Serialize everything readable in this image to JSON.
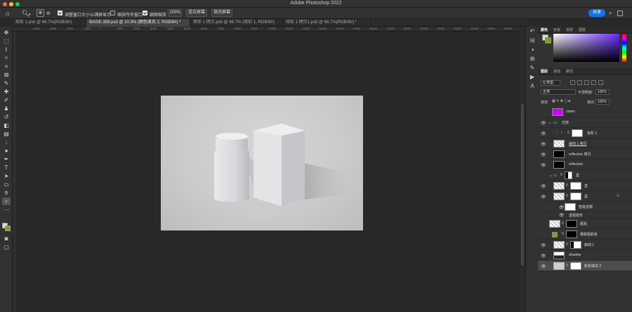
{
  "app": {
    "title": "Adobe Photoshop 2022"
  },
  "options_bar": {
    "resize_windows_label": "调整窗口大小以满屏显示",
    "zoom_all_label": "缩放所有窗口",
    "scrubby_zoom_label": "细微缩放",
    "zoom_value": "100%",
    "fit_screen_label": "适合屏幕",
    "fill_screen_label": "填充屏幕",
    "share_label": "共享"
  },
  "tabs": [
    {
      "label": "矩形 1.psb @ 66.7%(RGB/8#)"
    },
    {
      "label": "BAISE.359.psd @ 10.3% (颜色填充 2, RGB/8#) *"
    },
    {
      "label": "矩形 1 拷贝.psb @ 66.7% (矩形 1, RGB/8#)"
    },
    {
      "label": "矩形 1 拷贝1.psb @ 66.7%(RGB/8#) *"
    }
  ],
  "ruler": {
    "ticks": [
      "-4000",
      "-3000",
      "-2000",
      "-1000",
      "0",
      "1000",
      "2000",
      "3000",
      "4000",
      "5000",
      "6000",
      "7000",
      "8000",
      "9000",
      "10000",
      "11000",
      "12000",
      "13000",
      "14000",
      "15000",
      "16000",
      "17000",
      "18000",
      "19000",
      "20000",
      "21000",
      "22000",
      "23000",
      "24000",
      "25000",
      "26000"
    ]
  },
  "color_panel": {
    "tabs": [
      "颜色",
      "色板",
      "渐变",
      "图案"
    ],
    "fg": "#d7e2d1",
    "bg": "#7ba31c"
  },
  "layers_panel": {
    "tabs": [
      "图层",
      "通道",
      "路径"
    ],
    "filter_label": "Q 类型",
    "blend_mode": "正常",
    "opacity_label": "不透明度:",
    "opacity_value": "100%",
    "lock_label": "锁定:",
    "fill_label": "填充:",
    "fill_value": "100%",
    "layers": [
      {
        "name": "clown"
      },
      {
        "name": "光效"
      },
      {
        "name": "色阶 1"
      },
      {
        "name": "曲线 1 拷贝"
      },
      {
        "name": "reflection 拷贝"
      },
      {
        "name": "reflection"
      },
      {
        "name": "盒"
      },
      {
        "name": "盒"
      },
      {
        "name": "盒"
      },
      {
        "name": "智能滤镜"
      },
      {
        "name": "透视变形"
      },
      {
        "name": "瓶贴"
      },
      {
        "name": "橡胶瓶颜色"
      },
      {
        "name": "曲线 1"
      },
      {
        "name": "shadow"
      },
      {
        "name": "颜色填充 2"
      }
    ]
  }
}
